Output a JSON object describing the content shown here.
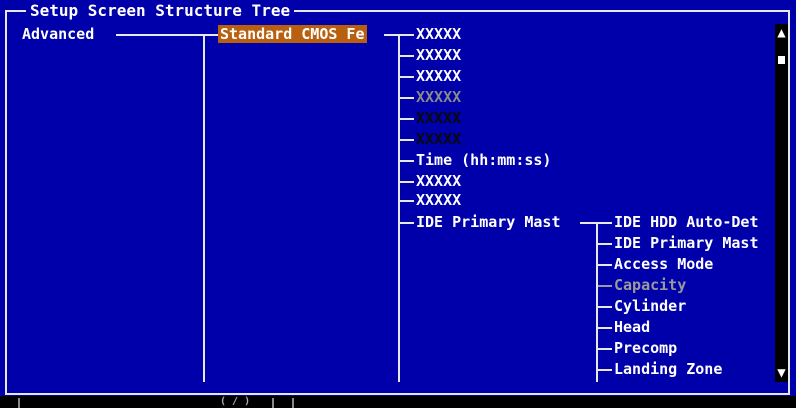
{
  "window": {
    "title": "Setup Screen Structure Tree"
  },
  "tree": {
    "root": "Advanced",
    "selected": "Standard CMOS Fe",
    "level2": [
      "XXXXX",
      "XXXXX",
      "XXXXX",
      "XXXXX",
      "XXXXX",
      "XXXXX",
      "Time (hh:mm:ss)",
      "XXXXX",
      "XXXXX",
      "IDE Primary Mast"
    ],
    "level3": [
      "IDE HDD Auto-Det",
      "IDE Primary Mast",
      "Access Mode",
      "Capacity",
      "Cylinder",
      "Head",
      "Precomp",
      "Landing Zone"
    ]
  },
  "scrollbar": {
    "up": "▲",
    "down": "▼"
  },
  "status": {
    "text": "( / )"
  },
  "colors": {
    "background": "#0000aa",
    "highlight": "#b86010",
    "foreground": "#ffffff",
    "disabled": "#9a9a9a"
  }
}
